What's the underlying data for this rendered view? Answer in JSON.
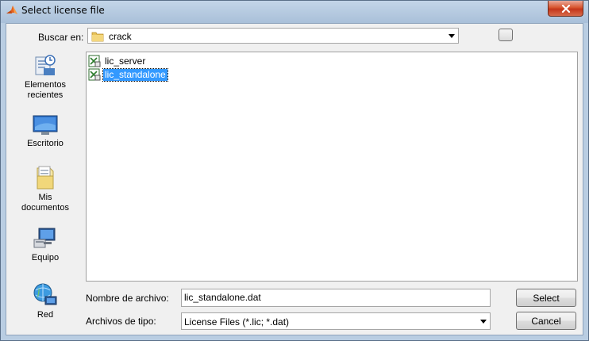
{
  "window": {
    "title": "Select license file"
  },
  "lookin": {
    "label": "Buscar en:",
    "value": "crack"
  },
  "places": [
    {
      "label_line1": "Elementos",
      "label_line2": "recientes",
      "icon": "recent-items-icon"
    },
    {
      "label_line1": "Escritorio",
      "label_line2": "",
      "icon": "desktop-icon"
    },
    {
      "label_line1": "Mis",
      "label_line2": "documentos",
      "icon": "documents-icon"
    },
    {
      "label_line1": "Equipo",
      "label_line2": "",
      "icon": "computer-icon"
    },
    {
      "label_line1": "Red",
      "label_line2": "",
      "icon": "network-icon"
    }
  ],
  "files": [
    {
      "name": "lic_server",
      "selected": false
    },
    {
      "name": "lic_standalone",
      "selected": true
    }
  ],
  "filename": {
    "label": "Nombre de archivo:",
    "value": "lic_standalone.dat"
  },
  "filetype": {
    "label": "Archivos de tipo:",
    "value": "License Files (*.lic; *.dat)"
  },
  "buttons": {
    "select": "Select",
    "cancel": "Cancel"
  }
}
